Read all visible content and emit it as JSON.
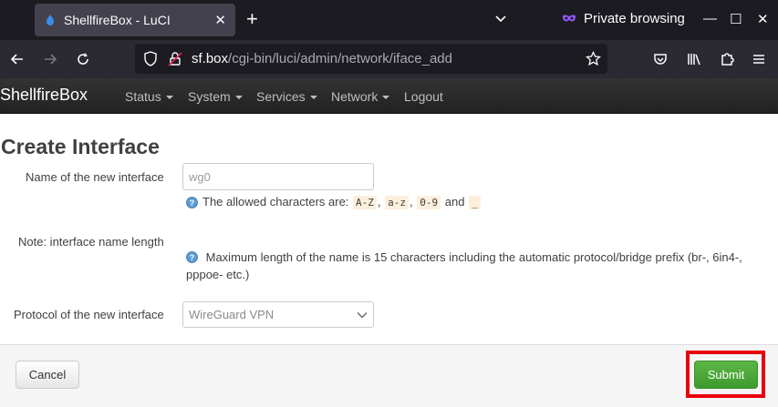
{
  "browser": {
    "tab_title": "ShellfireBox - LuCI",
    "tab_close": "✕",
    "new_tab": "+",
    "private_label": "Private browsing",
    "url_host": "sf.box",
    "url_path": "/cgi-bin/luci/admin/network/iface_add",
    "window_minimize": "—",
    "window_maximize": "☐",
    "window_close": "✕"
  },
  "luci": {
    "brand": "ShellfireBox",
    "menu": [
      {
        "label": "Status"
      },
      {
        "label": "System"
      },
      {
        "label": "Services"
      },
      {
        "label": "Network"
      },
      {
        "label": "Logout"
      }
    ]
  },
  "page": {
    "title": "Create Interface",
    "name_label": "Name of the new interface",
    "name_placeholder": "wg0",
    "allowed_prefix": "The allowed characters are:",
    "allowed_codes": [
      "A-Z",
      "a-z",
      "0-9",
      "_"
    ],
    "allowed_sep1": ",",
    "allowed_sep2": ",",
    "allowed_and": "and",
    "note_label": "Note: interface name length",
    "note_text": "Maximum length of the name is 15 characters including the automatic protocol/bridge prefix (br-, 6in4-, pppoe- etc.)",
    "protocol_label": "Protocol of the new interface",
    "protocol_value": "WireGuard VPN"
  },
  "actions": {
    "cancel": "Cancel",
    "submit": "Submit"
  },
  "colors": {
    "accent_submit": "#4aa638",
    "highlight_frame": "#e8000b",
    "header_bg": "#2b2b2b"
  }
}
